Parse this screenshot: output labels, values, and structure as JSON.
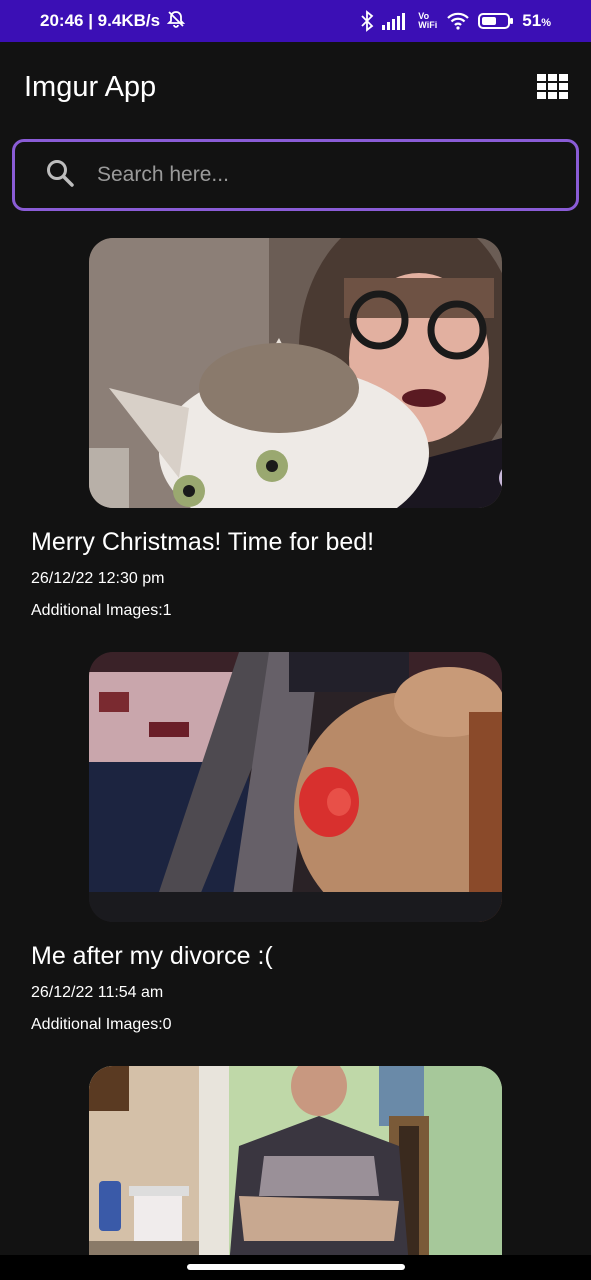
{
  "status_bar": {
    "time_speed": "20:46 | 9.4KB/s",
    "vowifi_label": "Vo\nWiFi",
    "battery": "51",
    "battery_unit": "%"
  },
  "app_bar": {
    "title": "Imgur App",
    "layout_icon": "grid-icon"
  },
  "search": {
    "placeholder": "Search here...",
    "value": ""
  },
  "posts": [
    {
      "title": "Merry Christmas! Time for bed!",
      "date": "26/12/22 12:30 pm",
      "extra_label": "Additional Images:",
      "extra_count": "1"
    },
    {
      "title": "Me after my divorce :(",
      "date": "26/12/22 11:54 am",
      "extra_label": "Additional Images:",
      "extra_count": "0"
    },
    {
      "title": "",
      "date": "",
      "extra_label": "",
      "extra_count": ""
    }
  ],
  "colors": {
    "status_bar": "#3b0fb5",
    "background": "#121212",
    "search_border": "#8a5cd6"
  }
}
